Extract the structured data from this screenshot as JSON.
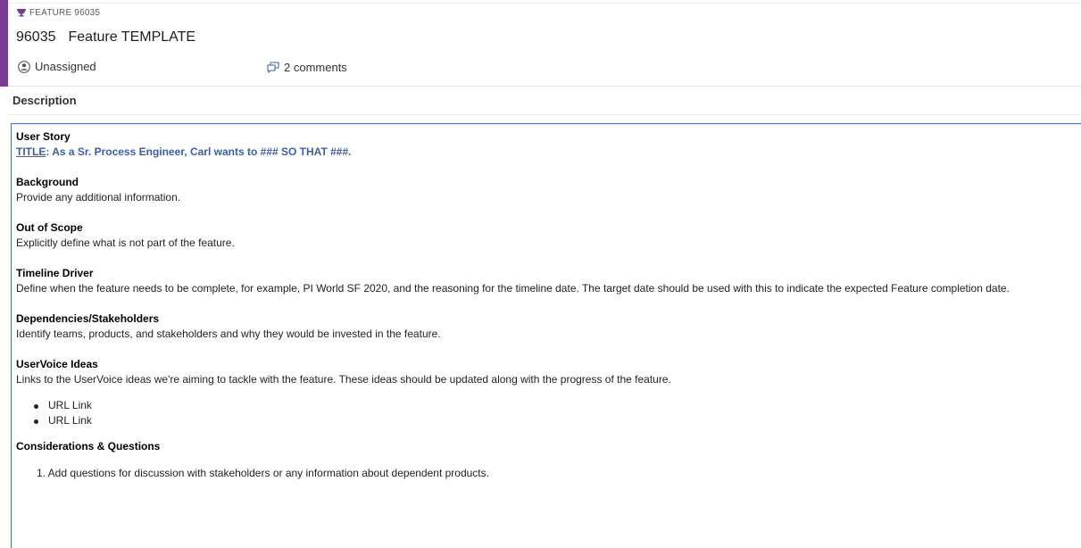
{
  "workitem": {
    "type_label": "FEATURE 96035",
    "id": "96035",
    "title": "Feature TEMPLATE",
    "assignee": "Unassigned",
    "comments": "2 comments",
    "accent_color": "#773b93"
  },
  "description": {
    "heading": "Description",
    "user_story": {
      "heading": "User Story",
      "title_label": "TITLE",
      "title_text": ": As a Sr. Process Engineer, Carl wants to ### SO THAT ###."
    },
    "background": {
      "heading": "Background",
      "text": "Provide any additional information."
    },
    "out_of_scope": {
      "heading": "Out of Scope",
      "text": "Explicitly define what is not part of the feature."
    },
    "timeline_driver": {
      "heading": "Timeline Driver",
      "text": "Define when the feature needs to be complete, for example, PI World SF 2020, and the reasoning for the timeline date. The target date should be used with this to indicate the expected Feature completion date."
    },
    "dependencies": {
      "heading": "Dependencies/Stakeholders",
      "text": "Identify teams, products, and stakeholders and why they would be invested in the feature."
    },
    "uservoice": {
      "heading": "UserVoice Ideas",
      "text": "Links to the UserVoice ideas we're aiming to tackle with the feature. These ideas should be updated along with the progress of the feature.",
      "links": [
        "URL Link",
        "URL Link"
      ]
    },
    "considerations": {
      "heading": "Considerations & Questions",
      "items": [
        "1. Add questions for discussion with stakeholders or any information about dependent products."
      ]
    }
  },
  "icons": {
    "type_icon": "trophy-icon",
    "assignee_icon": "person-avatar-icon",
    "comments_icon": "comment-icon"
  },
  "colors": {
    "accent": "#773b93",
    "editor_border": "#4b73c3",
    "link_blue": "#3a5ea8"
  }
}
